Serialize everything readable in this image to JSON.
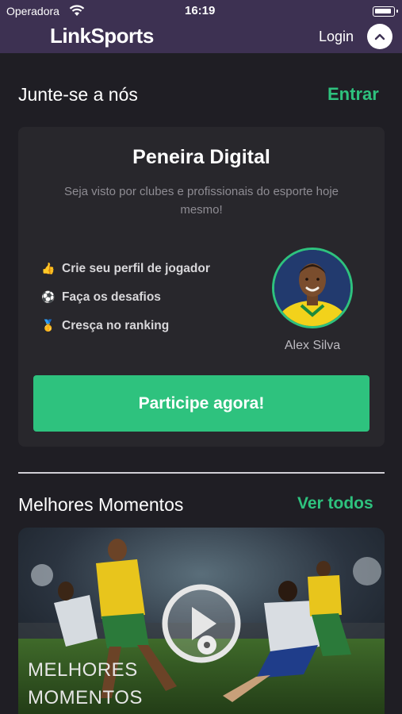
{
  "status_bar": {
    "carrier": "Operadora",
    "time": "16:19"
  },
  "header": {
    "logo": "LinkSports",
    "login_label": "Login"
  },
  "join_section": {
    "title": "Junte-se a nós",
    "action_label": "Entrar",
    "card": {
      "title": "Peneira Digital",
      "subtitle": "Seja visto por clubes e profissionais do esporte hoje mesmo!",
      "features": [
        {
          "icon": "👍",
          "text": "Crie seu perfil de jogador"
        },
        {
          "icon": "⚽",
          "text": "Faça os desafios"
        },
        {
          "icon": "🥇",
          "text": "Cresça no ranking"
        }
      ],
      "player_name": "Alex Silva",
      "cta_label": "Participe agora!"
    }
  },
  "highlights_section": {
    "title": "Melhores Momentos",
    "action_label": "Ver todos",
    "video_label_line1": "MELHORES",
    "video_label_line2": "MOMENTOS"
  },
  "colors": {
    "accent": "#2ec27e",
    "header_bg": "#3d3152",
    "page_bg": "#1f1e24",
    "card_bg": "#28272c"
  }
}
